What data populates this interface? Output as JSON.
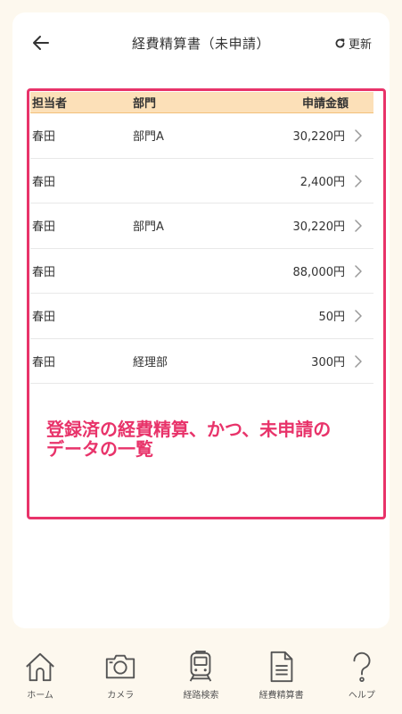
{
  "header": {
    "title": "経費精算書（未申請）",
    "refresh_label": "更新"
  },
  "table": {
    "columns": [
      "担当者",
      "部門",
      "申請金額"
    ],
    "rows": [
      {
        "person": "春田",
        "dept": "部門A",
        "amount": "30,220円"
      },
      {
        "person": "春田",
        "dept": "",
        "amount": "2,400円"
      },
      {
        "person": "春田",
        "dept": "部門A",
        "amount": "30,220円"
      },
      {
        "person": "春田",
        "dept": "",
        "amount": "88,000円"
      },
      {
        "person": "春田",
        "dept": "",
        "amount": "50円"
      },
      {
        "person": "春田",
        "dept": "経理部",
        "amount": "300円"
      }
    ]
  },
  "annotation": {
    "line1": "登録済の経費精算、かつ、未申請の",
    "line2": "データの一覧",
    "color": "#e8336a"
  },
  "bottom_nav": [
    {
      "label": "ホーム",
      "icon": "home-icon"
    },
    {
      "label": "カメラ",
      "icon": "camera-icon"
    },
    {
      "label": "経路検索",
      "icon": "train-icon"
    },
    {
      "label": "経費精算書",
      "icon": "document-icon"
    },
    {
      "label": "ヘルプ",
      "icon": "help-icon"
    }
  ]
}
